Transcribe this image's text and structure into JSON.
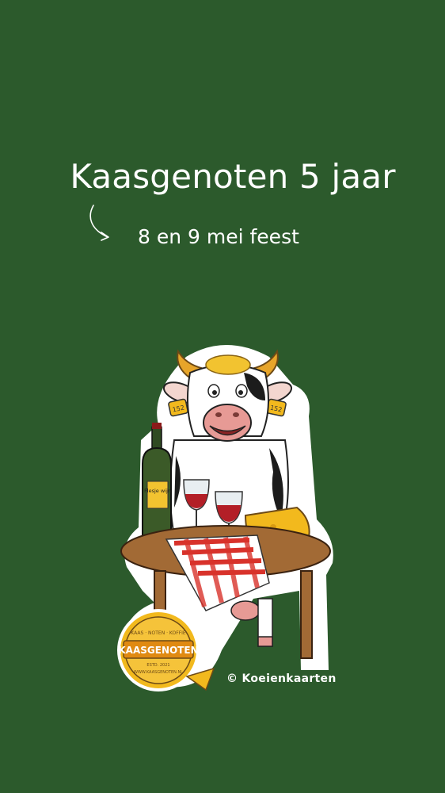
{
  "headline": "Kaasgenoten 5 jaar",
  "subheadline": "8 en 9 mei feest",
  "copyright": "© Koeienkaarten",
  "illustration": {
    "bottle_label": "Flesje wijn",
    "ear_tag_number": "152",
    "logo_name": "KAASGENOTEN",
    "logo_tagline": "KAAS · NOTEN · KOFFIE",
    "logo_established": "ESTD. 2021",
    "logo_url": "WWW.KAASGENOTEN.NL"
  },
  "colors": {
    "background": "#2c5a2c",
    "text": "#ffffff",
    "cheese": "#f2b91d",
    "tablecloth": "#d8322b"
  },
  "icons": [
    "curved-arrow-icon"
  ]
}
